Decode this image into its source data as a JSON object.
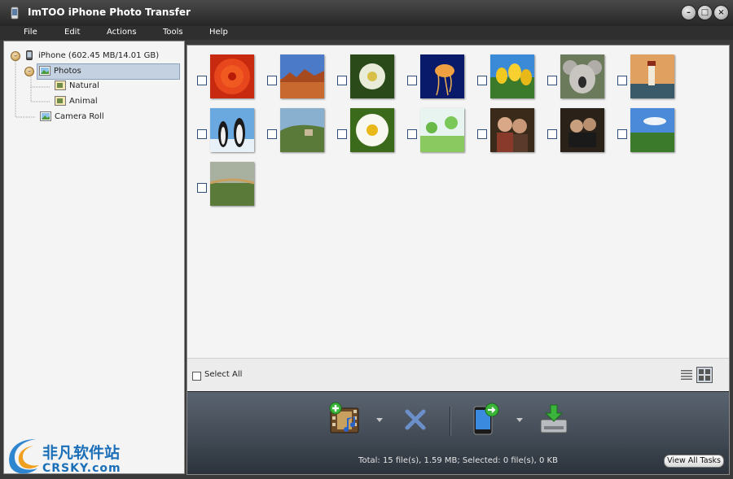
{
  "window": {
    "title": "ImTOO iPhone Photo Transfer",
    "controls": [
      "minimize-icon",
      "maximize-icon",
      "close-icon"
    ]
  },
  "menu": {
    "items": [
      {
        "label": "File"
      },
      {
        "label": "Edit"
      },
      {
        "label": "Actions"
      },
      {
        "label": "Tools"
      },
      {
        "label": "Help"
      }
    ]
  },
  "tree": {
    "device": "iPhone (602.45 MB/14.01 GB)",
    "photos": "Photos",
    "natural": "Natural",
    "animal": "Animal",
    "camera_roll": "Camera Roll",
    "selected": "Photos"
  },
  "photos": [
    {
      "subject": "red-flower",
      "checked": false
    },
    {
      "subject": "desert-canyon",
      "checked": false
    },
    {
      "subject": "white-flower",
      "checked": false
    },
    {
      "subject": "jellyfish",
      "checked": false
    },
    {
      "subject": "yellow-tulips",
      "checked": false
    },
    {
      "subject": "koala",
      "checked": false
    },
    {
      "subject": "lighthouse",
      "checked": false
    },
    {
      "subject": "penguins",
      "checked": false
    },
    {
      "subject": "hills-house",
      "checked": false
    },
    {
      "subject": "daisy",
      "checked": false
    },
    {
      "subject": "green-meadow",
      "checked": false
    },
    {
      "subject": "two-women",
      "checked": false
    },
    {
      "subject": "couple-indoor",
      "checked": false
    },
    {
      "subject": "blue-sky-field",
      "checked": false
    },
    {
      "subject": "field-sunset",
      "checked": false
    }
  ],
  "selection": {
    "select_all_label": "Select All",
    "select_all_checked": false
  },
  "toolbar": {
    "buttons": [
      "add-to-device-icon",
      "delete-icon",
      "phone-transfer-icon",
      "export-to-pc-icon"
    ]
  },
  "status": {
    "text": "Total: 15 file(s), 1.59 MB; Selected: 0 file(s), 0 KB",
    "view_all_tasks": "View All Tasks"
  },
  "watermark": {
    "cn": "非凡软件站",
    "en": "CRSKY.com"
  },
  "colors": {
    "selected_row": "#c4d1e0",
    "toolbar_bg": "#4a535e",
    "watermark": "#1a6fb8"
  }
}
